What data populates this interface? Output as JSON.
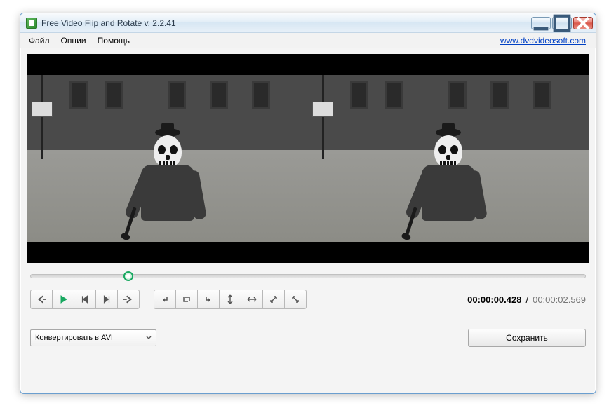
{
  "titlebar": {
    "title": "Free Video Flip and Rotate v. 2.2.41"
  },
  "menubar": {
    "file": "Файл",
    "options": "Опции",
    "help": "Помощь",
    "link": "www.dvdvideosoft.com"
  },
  "time": {
    "current": "00:00:00.428",
    "separator": "/",
    "total": "00:00:02.569"
  },
  "format": {
    "selected": "Конвертировать в AVI"
  },
  "buttons": {
    "save": "Сохранить"
  },
  "playback_progress_percent": 16.7
}
